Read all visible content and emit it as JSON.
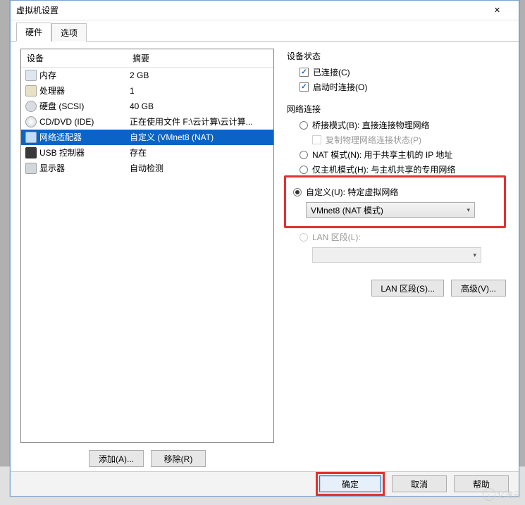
{
  "window": {
    "title": "虚拟机设置"
  },
  "tabs": {
    "hardware": "硬件",
    "options": "选项"
  },
  "list": {
    "head_device": "设备",
    "head_summary": "摘要",
    "rows": [
      {
        "name": "内存",
        "summary": "2 GB"
      },
      {
        "name": "处理器",
        "summary": "1"
      },
      {
        "name": "硬盘 (SCSI)",
        "summary": "40 GB"
      },
      {
        "name": "CD/DVD (IDE)",
        "summary": "正在使用文件 F:\\云计算\\云计算..."
      },
      {
        "name": "网络适配器",
        "summary": "自定义 (VMnet8 (NAT)"
      },
      {
        "name": "USB 控制器",
        "summary": "存在"
      },
      {
        "name": "显示器",
        "summary": "自动检测"
      }
    ],
    "selected_index": 4
  },
  "left_buttons": {
    "add": "添加(A)...",
    "remove": "移除(R)"
  },
  "right": {
    "status_title": "设备状态",
    "connected": "已连接(C)",
    "connect_at_poweron": "启动时连接(O)",
    "netconn_title": "网络连接",
    "bridged": "桥接模式(B): 直接连接物理网络",
    "replicate": "复制物理网络连接状态(P)",
    "nat": "NAT 模式(N): 用于共享主机的 IP 地址",
    "hostonly": "仅主机模式(H): 与主机共享的专用网络",
    "custom": "自定义(U): 特定虚拟网络",
    "custom_value": "VMnet8 (NAT 模式)",
    "lanseg": "LAN 区段(L):",
    "lanseg_value": "",
    "lan_btn": "LAN 区段(S)...",
    "adv_btn": "高级(V)..."
  },
  "footer": {
    "ok": "确定",
    "cancel": "取消",
    "help": "帮助"
  },
  "watermark": "亿速云"
}
